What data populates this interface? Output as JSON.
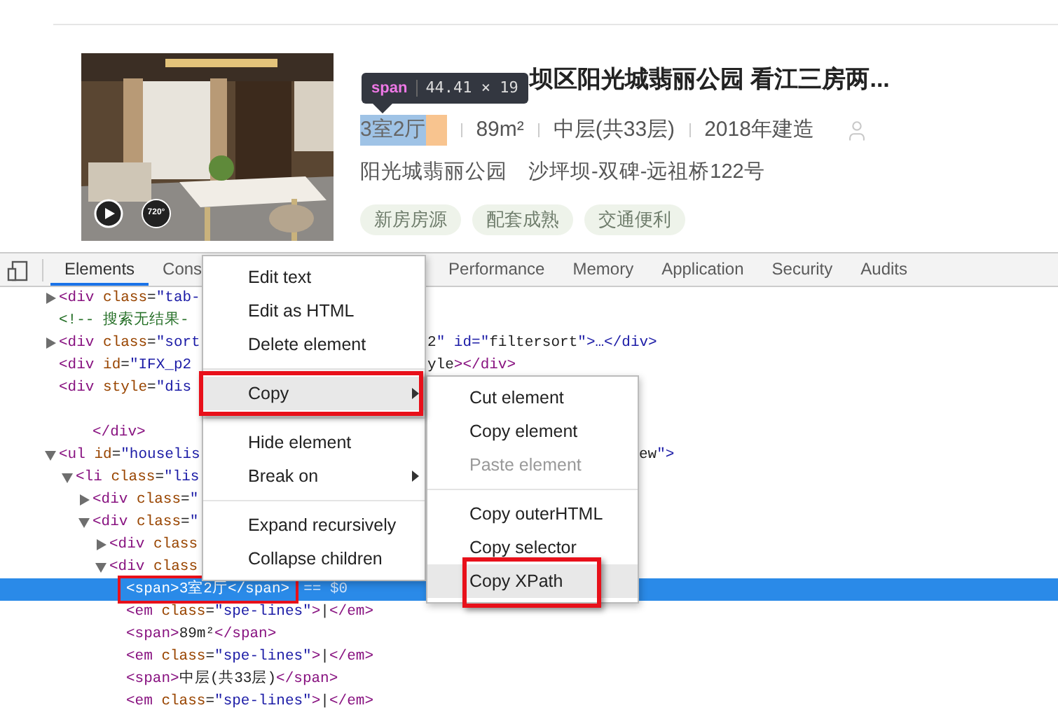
{
  "listing": {
    "title": "坝区阳光城翡丽公园 看江三房两...",
    "tooltip": {
      "tag": "span",
      "size": "44.41 × 19"
    },
    "facts": [
      {
        "text": "3室2厅",
        "inspected": true
      },
      {
        "text": "89m²",
        "inspected": false
      },
      {
        "text": "中层(共33层)",
        "inspected": false
      },
      {
        "text": "2018年建造",
        "inspected": false
      }
    ],
    "address": [
      "阳光城翡丽公园",
      "沙坪坝-双碑-远祖桥122号"
    ],
    "tags": [
      "新房房源",
      "配套成熟",
      "交通便利"
    ],
    "media": {
      "kind": "picture",
      "panorama_badge": "720°"
    }
  },
  "devtools": {
    "tabs": [
      {
        "label": "Elements",
        "selected": true,
        "partial": false
      },
      {
        "label": "Cons",
        "selected": false,
        "partial": true
      },
      {
        "label": "Performance",
        "selected": false,
        "partial": false
      },
      {
        "label": "Memory",
        "selected": false,
        "partial": false
      },
      {
        "label": "Application",
        "selected": false,
        "partial": false
      },
      {
        "label": "Security",
        "selected": false,
        "partial": false
      },
      {
        "label": "Audits",
        "selected": false,
        "partial": false
      }
    ],
    "lines": [
      {
        "kind": "node",
        "expanded": false,
        "text": "<div class=\"tab-",
        "selected": false,
        "marked": false
      },
      {
        "kind": "leaf",
        "text": "<!-- 搜索无结果-",
        "selected": false,
        "marked": false
      },
      {
        "kind": "node",
        "expanded": false,
        "text": "<div class=\"sort",
        "tail": {
          "kind": "after_menu",
          "text": "2\" id=\"filtersort\">…</div>"
        },
        "selected": false,
        "marked": false
      },
      {
        "kind": "leaf",
        "text": "<div id=\"IFX_p2",
        "tail": {
          "kind": "after_menu",
          "text": "yle></div>"
        },
        "selected": false,
        "marked": false
      },
      {
        "kind": "leaf",
        "text": "<div style=\"dis",
        "selected": false,
        "marked": false,
        "children": [
          {
            "kind": "blank",
            "children": [
              {
                "kind": "leaf",
                "text": "</div>",
                "selected": false,
                "marked": false
              }
            ]
          }
        ]
      },
      {
        "kind": "node",
        "expanded": true,
        "text": "<ul id=\"houselis",
        "tail": {
          "kind": "after_submenu",
          "text": "ew\">"
        },
        "selected": false,
        "marked": false,
        "children": [
          {
            "kind": "node",
            "expanded": true,
            "text": "<li class=\"lis",
            "selected": false,
            "marked": false,
            "children": [
              {
                "kind": "node",
                "expanded": false,
                "text": "<div class=\"",
                "selected": false,
                "marked": false
              },
              {
                "kind": "node",
                "expanded": true,
                "text": "<div class=\"",
                "selected": false,
                "marked": false,
                "children": [
                  {
                    "kind": "node",
                    "expanded": false,
                    "text": "<div class",
                    "selected": false,
                    "marked": false
                  },
                  {
                    "kind": "node",
                    "expanded": true,
                    "text": "<div class",
                    "selected": false,
                    "marked": false,
                    "children": [
                      {
                        "kind": "leaf",
                        "text": "<span>3室2厅</span>",
                        "suffix": "== $0",
                        "selected": true,
                        "marked": true
                      },
                      {
                        "kind": "leaf",
                        "text": "<em class=\"spe-lines\">|</em>",
                        "selected": false,
                        "marked": false
                      },
                      {
                        "kind": "leaf",
                        "text": "<span>89m²</span>",
                        "selected": false,
                        "marked": false
                      },
                      {
                        "kind": "leaf",
                        "text": "<em class=\"spe-lines\">|</em>",
                        "selected": false,
                        "marked": false
                      },
                      {
                        "kind": "leaf",
                        "text": "<span>中层(共33层)</span>",
                        "selected": false,
                        "marked": false
                      },
                      {
                        "kind": "leaf",
                        "text": "<em class=\"spe-lines\">|</em>",
                        "selected": false,
                        "marked": false
                      }
                    ]
                  }
                ]
              }
            ]
          }
        ]
      }
    ],
    "context_menu": {
      "items": [
        {
          "kind": "item",
          "label": "Edit text",
          "highlighted": false,
          "disabled": false,
          "has_submenu": false,
          "marked": false
        },
        {
          "kind": "item",
          "label": "Edit as HTML",
          "highlighted": false,
          "disabled": false,
          "has_submenu": false,
          "marked": false
        },
        {
          "kind": "item",
          "label": "Delete element",
          "highlighted": false,
          "disabled": false,
          "has_submenu": false,
          "marked": false
        },
        {
          "kind": "separator"
        },
        {
          "kind": "item",
          "label": "Copy",
          "highlighted": true,
          "disabled": false,
          "has_submenu": true,
          "marked": true
        },
        {
          "kind": "separator"
        },
        {
          "kind": "item",
          "label": "Hide element",
          "highlighted": false,
          "disabled": false,
          "has_submenu": false,
          "marked": false
        },
        {
          "kind": "item",
          "label": "Break on",
          "highlighted": false,
          "disabled": false,
          "has_submenu": true,
          "marked": false
        },
        {
          "kind": "separator"
        },
        {
          "kind": "item",
          "label": "Expand recursively",
          "highlighted": false,
          "disabled": false,
          "has_submenu": false,
          "marked": false
        },
        {
          "kind": "item",
          "label": "Collapse children",
          "highlighted": false,
          "disabled": false,
          "has_submenu": false,
          "marked": false
        }
      ]
    },
    "submenu": {
      "items": [
        {
          "kind": "item",
          "label": "Cut element",
          "highlighted": false,
          "disabled": false,
          "marked": false
        },
        {
          "kind": "item",
          "label": "Copy element",
          "highlighted": false,
          "disabled": false,
          "marked": false
        },
        {
          "kind": "item",
          "label": "Paste element",
          "highlighted": false,
          "disabled": true,
          "marked": false
        },
        {
          "kind": "separator"
        },
        {
          "kind": "item",
          "label": "Copy outerHTML",
          "highlighted": false,
          "disabled": false,
          "marked": false
        },
        {
          "kind": "item",
          "label": "Copy selector",
          "highlighted": false,
          "disabled": false,
          "marked": false
        },
        {
          "kind": "item",
          "label": "Copy XPath",
          "highlighted": true,
          "disabled": false,
          "marked": true
        }
      ]
    }
  }
}
